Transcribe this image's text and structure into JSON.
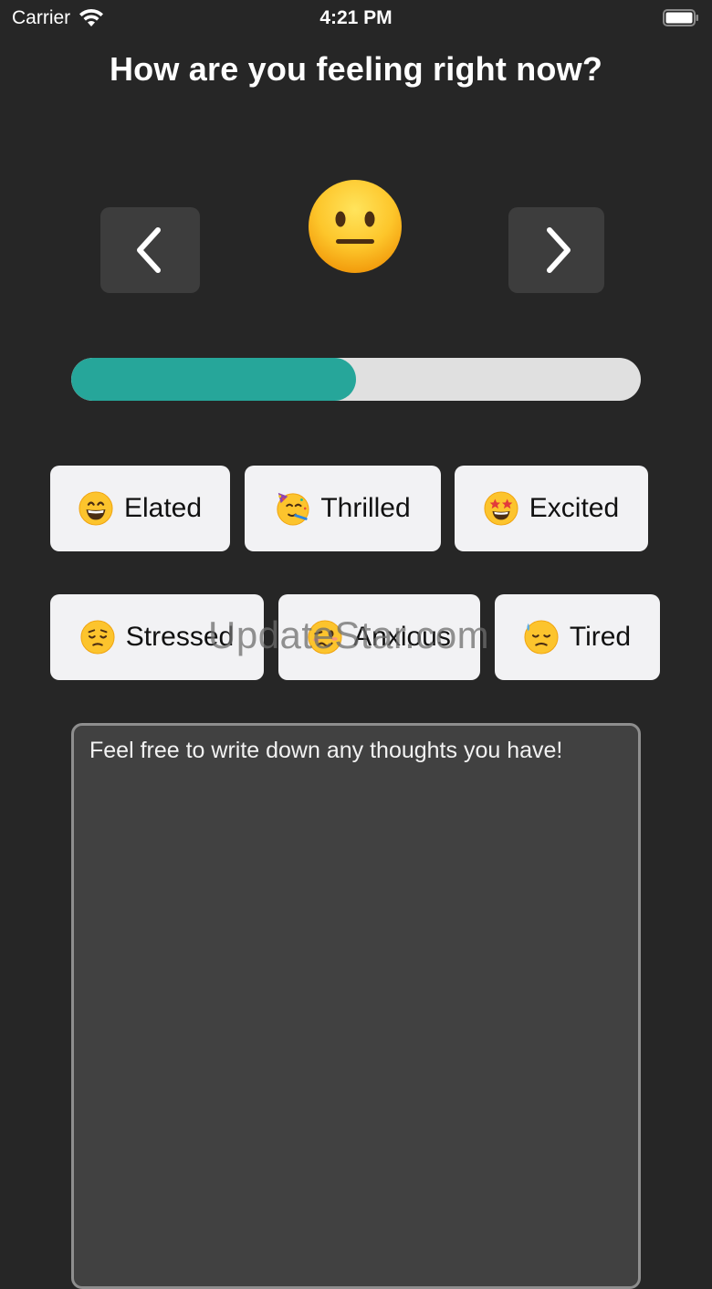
{
  "status_bar": {
    "carrier": "Carrier",
    "time": "4:21 PM"
  },
  "title": "How are you feeling right now?",
  "mood": {
    "current_face": "neutral-face-icon",
    "level_fraction": 0.5
  },
  "moods_row1": [
    {
      "label": "Elated",
      "icon": "grinning-face-icon"
    },
    {
      "label": "Thrilled",
      "icon": "partying-face-icon"
    },
    {
      "label": "Excited",
      "icon": "star-struck-face-icon"
    }
  ],
  "moods_row2": [
    {
      "label": "Stressed",
      "icon": "pensive-face-icon"
    },
    {
      "label": "Anxious",
      "icon": "woozy-face-icon"
    },
    {
      "label": "Tired",
      "icon": "downcast-sweat-face-icon"
    }
  ],
  "notes": {
    "placeholder": "Feel free to write down any thoughts you have!",
    "value": ""
  },
  "watermark": "UpdateStar.com",
  "colors": {
    "background": "#262626",
    "accent": "#26a69a",
    "chip": "#f2f2f4",
    "nav_button": "#3d3d3d"
  }
}
